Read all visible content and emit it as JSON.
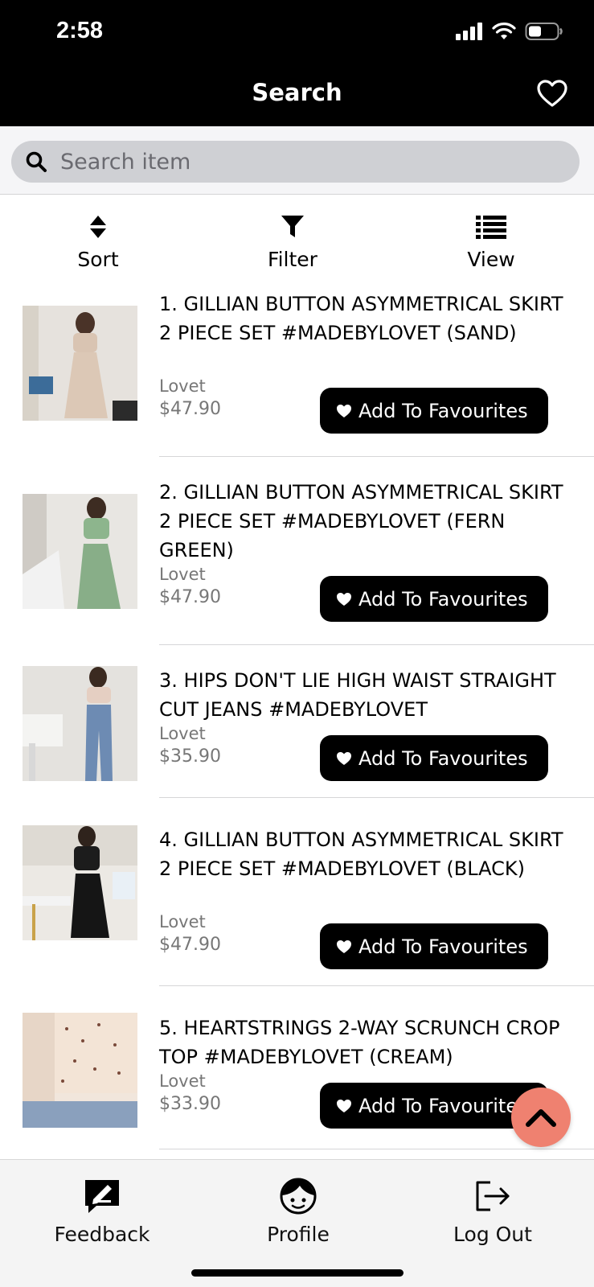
{
  "status": {
    "time": "2:58"
  },
  "nav": {
    "title": "Search"
  },
  "search": {
    "placeholder": "Search item"
  },
  "tools": {
    "sort": "Sort",
    "filter": "Filter",
    "view": "View"
  },
  "products": [
    {
      "title": "1. GILLIAN BUTTON ASYMMETRICAL SKIRT 2 PIECE SET #MADEBYLOVET (SAND)",
      "brand": "Lovet",
      "price": "$47.90",
      "button": "Add To Favourites"
    },
    {
      "title": "2. GILLIAN BUTTON ASYMMETRICAL SKIRT 2 PIECE SET #MADEBYLOVET (FERN GREEN)",
      "brand": "Lovet",
      "price": "$47.90",
      "button": "Add To Favourites"
    },
    {
      "title": "3. HIPS DON'T LIE HIGH WAIST STRAIGHT CUT JEANS #MADEBYLOVET",
      "brand": "Lovet",
      "price": "$35.90",
      "button": "Add To Favourites"
    },
    {
      "title": "4. GILLIAN BUTTON ASYMMETRICAL SKIRT 2 PIECE SET #MADEBYLOVET (BLACK)",
      "brand": "Lovet",
      "price": "$47.90",
      "button": "Add To Favourites"
    },
    {
      "title": "5. HEARTSTRINGS 2-WAY SCRUNCH CROP TOP #MADEBYLOVET (CREAM)",
      "brand": "Lovet",
      "price": "$33.90",
      "button": "Add To Favourites"
    }
  ],
  "tabbar": {
    "feedback": "Feedback",
    "profile": "Profile",
    "logout": "Log Out"
  },
  "colors": {
    "accent": "#ef8170",
    "bar": "#000000",
    "search_bg": "#cfd0d4"
  }
}
